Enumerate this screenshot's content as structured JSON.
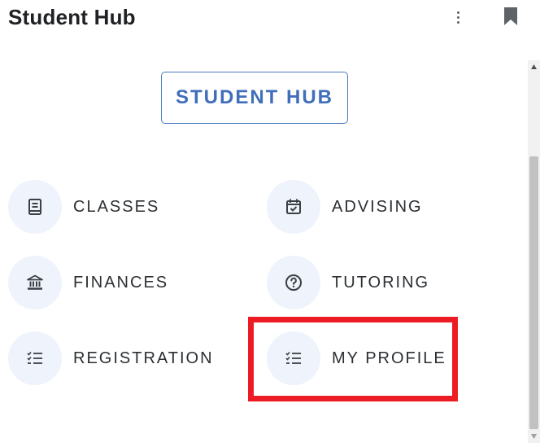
{
  "header": {
    "title": "Student Hub",
    "more_icon": "more-vert-icon",
    "bookmark_icon": "bookmark-icon"
  },
  "hub_button": {
    "label": "STUDENT HUB"
  },
  "tiles": [
    {
      "label": "CLASSES",
      "icon": "book-icon"
    },
    {
      "label": "ADVISING",
      "icon": "calendar-check-icon"
    },
    {
      "label": "FINANCES",
      "icon": "bank-icon"
    },
    {
      "label": "TUTORING",
      "icon": "help-circle-icon"
    },
    {
      "label": "REGISTRATION",
      "icon": "checklist-icon"
    },
    {
      "label": "MY PROFILE",
      "icon": "checklist-icon"
    }
  ],
  "colors": {
    "accent": "#3f6fba",
    "tile_background": "#eef3fc",
    "highlight": "#ed1c24"
  }
}
